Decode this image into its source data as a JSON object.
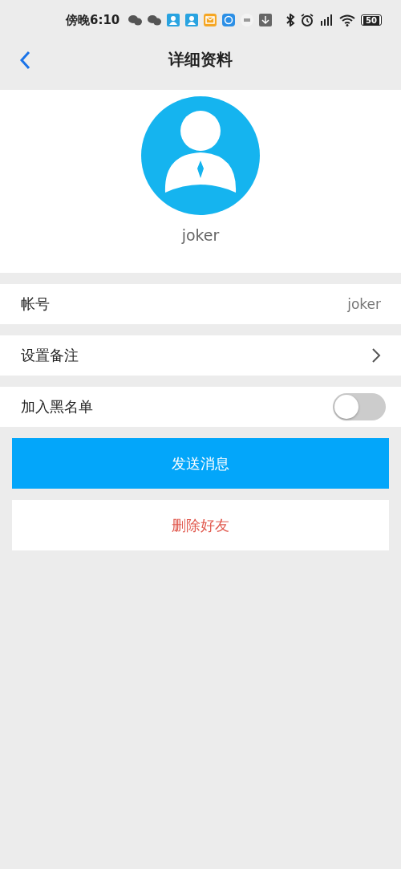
{
  "status_bar": {
    "time": "傍晚6:10",
    "battery": "50"
  },
  "header": {
    "title": "详细资料"
  },
  "profile": {
    "name": "joker"
  },
  "rows": [
    {
      "kind": "value",
      "label": "帐号",
      "value": "joker"
    },
    {
      "kind": "link",
      "label": "设置备注"
    },
    {
      "kind": "switch",
      "label": "加入黑名单",
      "on": false
    }
  ],
  "buttons": [
    {
      "kind": "primary",
      "label": "发送消息"
    },
    {
      "kind": "danger",
      "label": "删除好友"
    }
  ]
}
